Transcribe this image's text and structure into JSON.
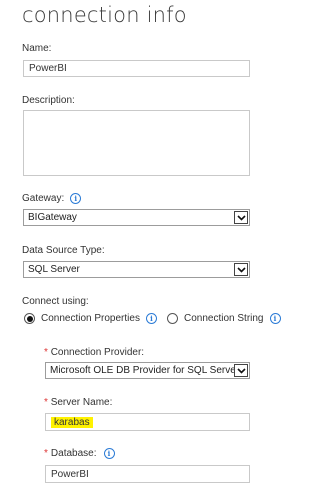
{
  "title": "connection info",
  "name": {
    "label": "Name:",
    "value": "PowerBI"
  },
  "description": {
    "label": "Description:",
    "value": ""
  },
  "gateway": {
    "label": "Gateway:",
    "value": "BIGateway"
  },
  "data_source_type": {
    "label": "Data Source Type:",
    "value": "SQL Server"
  },
  "connect_using": {
    "label": "Connect using:",
    "option_properties": "Connection Properties",
    "option_string": "Connection String",
    "selected": "Connection Properties"
  },
  "connection_provider": {
    "required_mark": "*",
    "label": "Connection Provider:",
    "value": "Microsoft OLE DB Provider for SQL Server"
  },
  "server_name": {
    "required_mark": "*",
    "label": "Server Name:",
    "value": "karabas"
  },
  "database": {
    "required_mark": "*",
    "label": "Database:",
    "value": "PowerBI"
  },
  "colors": {
    "info_icon": "#2b7bd6",
    "required": "#dd3333",
    "highlight": "#fff200"
  }
}
